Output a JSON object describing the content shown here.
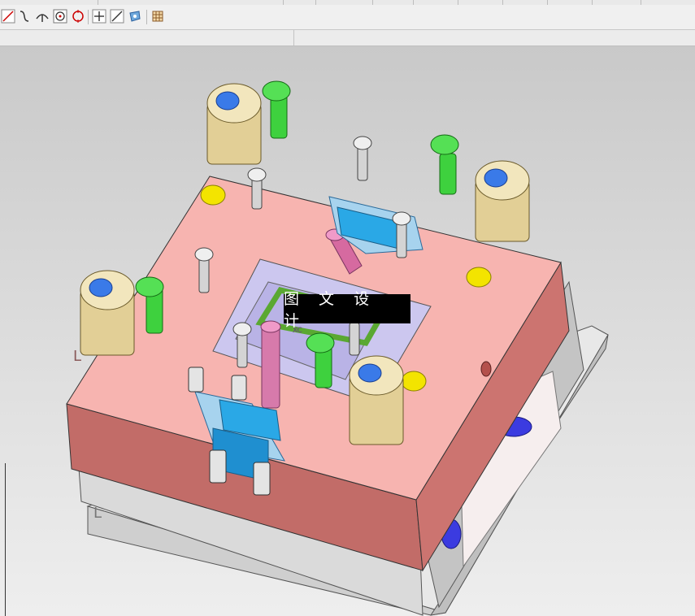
{
  "toolbar": {
    "icons": [
      "line-icon",
      "curve-icon",
      "branch-icon",
      "circle-dot-icon",
      "circle-target-icon",
      "cross-icon",
      "diagonal-line-icon",
      "view-icon",
      "grid-icon"
    ]
  },
  "viewport": {
    "watermark": "图 文 设 计",
    "labels": {
      "corner_mark_left": "L",
      "corner_mark_bottom": "L",
      "small_tag": "XC"
    }
  },
  "colors": {
    "plate_pink": "#f0a3a0",
    "plate_side": "#c06a66",
    "base_grey": "#dcdcdc",
    "bushing": "#d8c48a",
    "bolt_green": "#33cc33",
    "slider_blue": "#2fa8e0",
    "pin_magenta": "#d66aa0",
    "insert_lavender": "#c8c2ec",
    "marker_yellow": "#f3e100"
  }
}
